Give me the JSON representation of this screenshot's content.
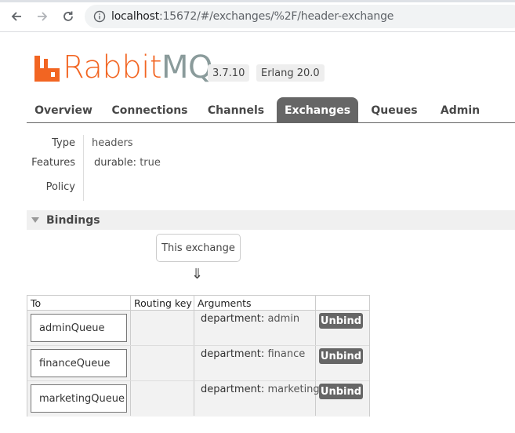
{
  "browser": {
    "url_host": "localhost",
    "url_rest": ":15672/#/exchanges/%2F/header-exchange"
  },
  "header": {
    "logo_rabbit": "Rabbit",
    "logo_mq": "MQ",
    "logo_tm": "TM",
    "version": "3.7.10",
    "erlang": "Erlang 20.0",
    "brand_color": "#f26522"
  },
  "tabs": [
    "Overview",
    "Connections",
    "Channels",
    "Exchanges",
    "Queues",
    "Admin"
  ],
  "active_tab": "Exchanges",
  "properties": {
    "type_label": "Type",
    "type_value": "headers",
    "features_label": "Features",
    "features_key": "durable:",
    "features_value": "true",
    "policy_label": "Policy"
  },
  "bindings": {
    "section_title": "Bindings",
    "this_exchange": "This exchange",
    "arrow": "⇓",
    "columns": [
      "To",
      "Routing key",
      "Arguments",
      ""
    ],
    "rows": [
      {
        "to": "adminQueue",
        "routing_key": "",
        "arg_key": "department:",
        "arg_value": "admin",
        "action": "Unbind"
      },
      {
        "to": "financeQueue",
        "routing_key": "",
        "arg_key": "department:",
        "arg_value": "finance",
        "action": "Unbind"
      },
      {
        "to": "marketingQueue",
        "routing_key": "",
        "arg_key": "department:",
        "arg_value": "marketing",
        "action": "Unbind"
      }
    ]
  }
}
